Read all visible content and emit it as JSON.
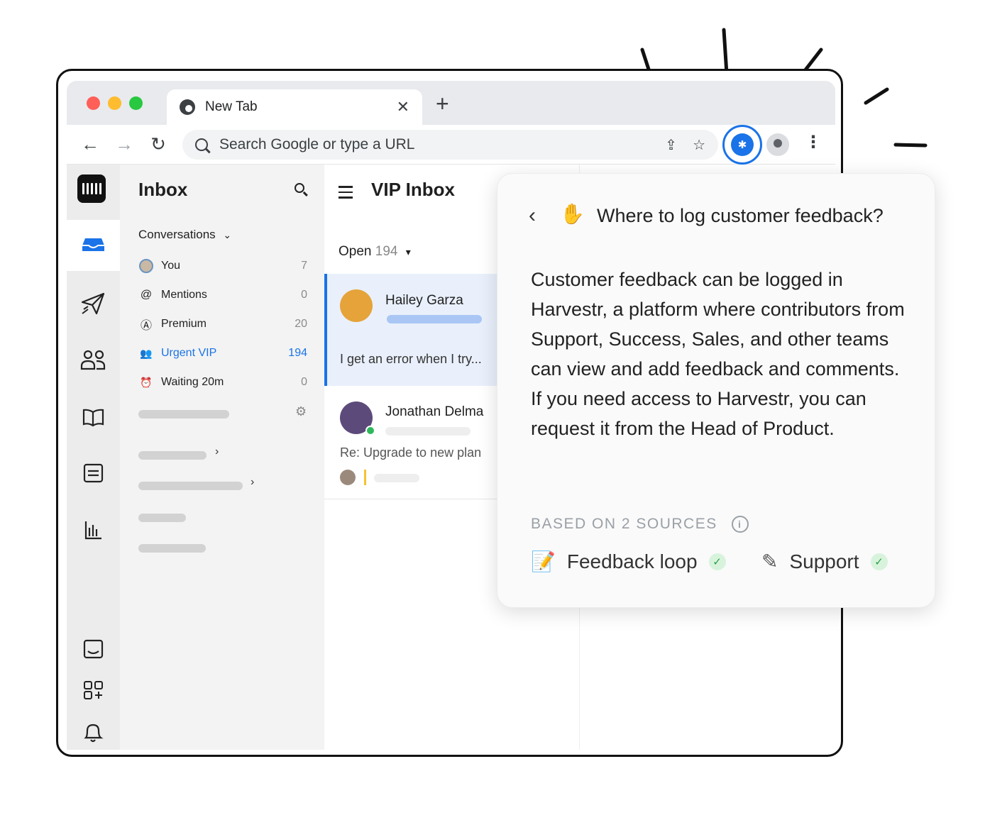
{
  "browser": {
    "tab_title": "New Tab",
    "tab_close": "✕",
    "new_tab": "+",
    "back": "←",
    "forward": "→",
    "reload": "↻",
    "omnibox_placeholder": "Search Google or type a URL",
    "share_icon": "⇪",
    "star_icon": "☆",
    "menu": "⋮",
    "traffic_lights": [
      "#ff5f57",
      "#febc2e",
      "#28c840"
    ],
    "accent": "#1a73e8"
  },
  "rail": {
    "icons": [
      "inbox-icon",
      "paper-plane-icon",
      "contacts-icon",
      "book-icon",
      "articles-icon",
      "reports-icon",
      "messenger-icon",
      "apps-icon",
      "bell-icon"
    ]
  },
  "sidebar": {
    "title": "Inbox",
    "section": "Conversations",
    "section_chevron": "⌄",
    "items": [
      {
        "label": "You",
        "count": "7"
      },
      {
        "label": "Mentions",
        "count": "0",
        "icon": "@"
      },
      {
        "label": "Premium",
        "count": "20",
        "icon": "Ⓐ"
      },
      {
        "label": "Urgent VIP",
        "count": "194",
        "icon": "👥"
      },
      {
        "label": "Waiting 20m",
        "count": "0",
        "icon": "⏰"
      }
    ],
    "gear": "⚙",
    "chevron": "›"
  },
  "conversations": {
    "title": "VIP Inbox",
    "filter_label": "Open",
    "filter_count": "194",
    "filter_caret": "▾",
    "list": [
      {
        "name": "Hailey Garza",
        "preview": "I get an error when I try..."
      },
      {
        "name": "Jonathan Delma",
        "preview": "Re: Upgrade to new plan"
      }
    ]
  },
  "card": {
    "back": "‹",
    "hand_icon": "✋",
    "title": "Where to log customer feedback?",
    "body": "Customer feedback can be logged in Harvestr, a platform where contributors from Support, Success, Sales, and other teams can view and add feedback and comments. If you need access to Harvestr, you can request it from the Head of Product.",
    "sources_label": "BASED ON 2 SOURCES",
    "info": "i",
    "sources": [
      {
        "label": "Feedback loop",
        "icon": "📝",
        "check": "✓"
      },
      {
        "label": "Support",
        "icon": "✎",
        "check": "✓"
      }
    ]
  }
}
